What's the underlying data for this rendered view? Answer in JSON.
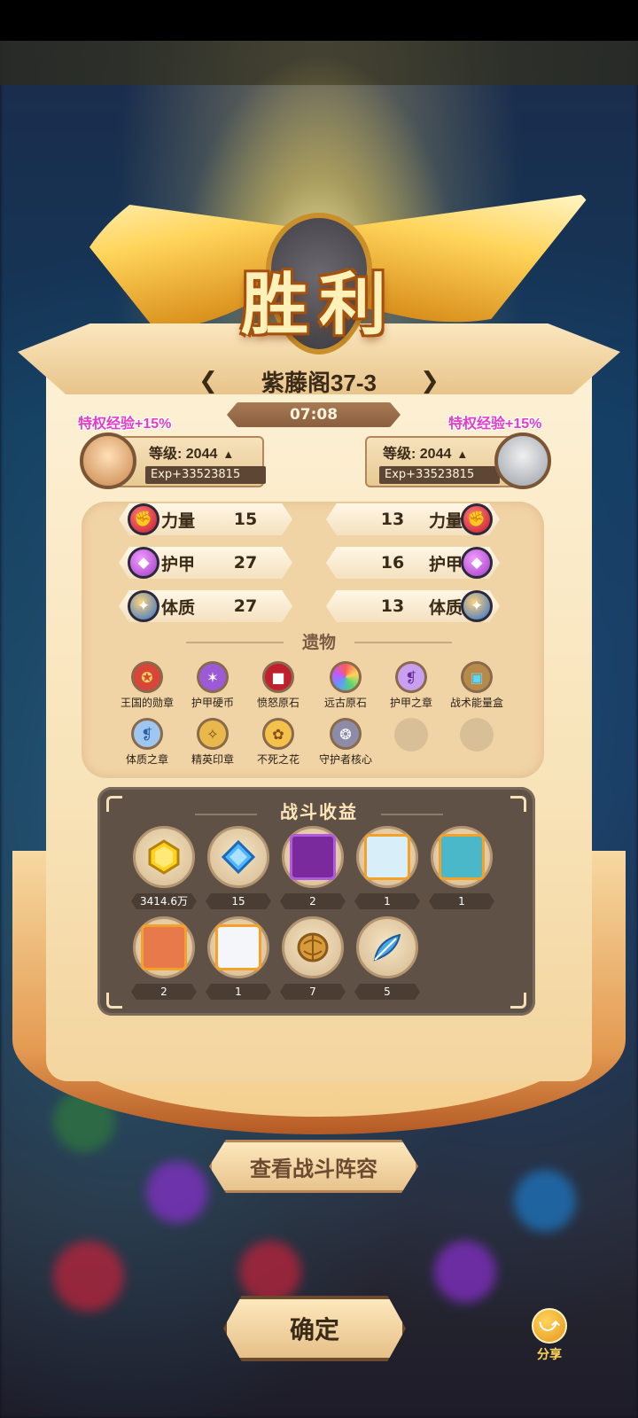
{
  "result": {
    "title": "胜利"
  },
  "stage": {
    "name": "紫藤阁37-3",
    "timer": "07:08"
  },
  "players": [
    {
      "bonus": "特权经验+15%",
      "level_label": "等级: 2044",
      "exp": "Exp+33523815"
    },
    {
      "bonus": "特权经验+15%",
      "level_label": "等级: 2044",
      "exp": "Exp+33523815"
    }
  ],
  "stats": [
    {
      "label": "力量",
      "left": "15",
      "right": "13",
      "icon": "fist-icon"
    },
    {
      "label": "护甲",
      "left": "27",
      "right": "16",
      "icon": "armor-icon"
    },
    {
      "label": "体质",
      "left": "27",
      "right": "13",
      "icon": "constitution-icon"
    }
  ],
  "relics": {
    "title": "遗物",
    "items": [
      {
        "label": "王国的勋章"
      },
      {
        "label": "护甲硬币"
      },
      {
        "label": "愤怒原石"
      },
      {
        "label": "远古原石"
      },
      {
        "label": "护甲之章"
      },
      {
        "label": "战术能量盒"
      },
      {
        "label": "体质之章"
      },
      {
        "label": "精英印章"
      },
      {
        "label": "不死之花"
      },
      {
        "label": "守护者核心"
      }
    ]
  },
  "rewards": {
    "title": "战斗收益",
    "items": [
      {
        "qty": "3414.6万",
        "icon": "gold-gem-icon"
      },
      {
        "qty": "15",
        "icon": "blue-diamond-icon"
      },
      {
        "qty": "2",
        "icon": "hero-card-icon"
      },
      {
        "qty": "1",
        "icon": "hero-card-icon"
      },
      {
        "qty": "1",
        "icon": "hero-card-icon"
      },
      {
        "qty": "2",
        "icon": "hero-card-icon"
      },
      {
        "qty": "1",
        "icon": "hero-card-icon"
      },
      {
        "qty": "7",
        "icon": "walnut-icon"
      },
      {
        "qty": "5",
        "icon": "feather-icon"
      }
    ]
  },
  "buttons": {
    "lineup": "查看战斗阵容",
    "confirm": "确定",
    "share": "分享"
  },
  "colors": {
    "bonus_text": "#e53cc8",
    "parchment": "#fdf1d6",
    "reward_panel": "#5f5146"
  }
}
